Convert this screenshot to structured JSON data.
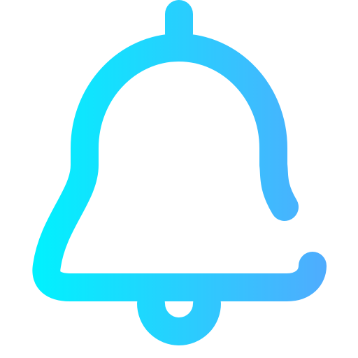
{
  "icon": {
    "name": "bell-icon",
    "style": "outline",
    "colors": {
      "gradient_start": "#00F2FE",
      "gradient_end": "#4FACFE",
      "background": "#FFFFFF"
    }
  }
}
